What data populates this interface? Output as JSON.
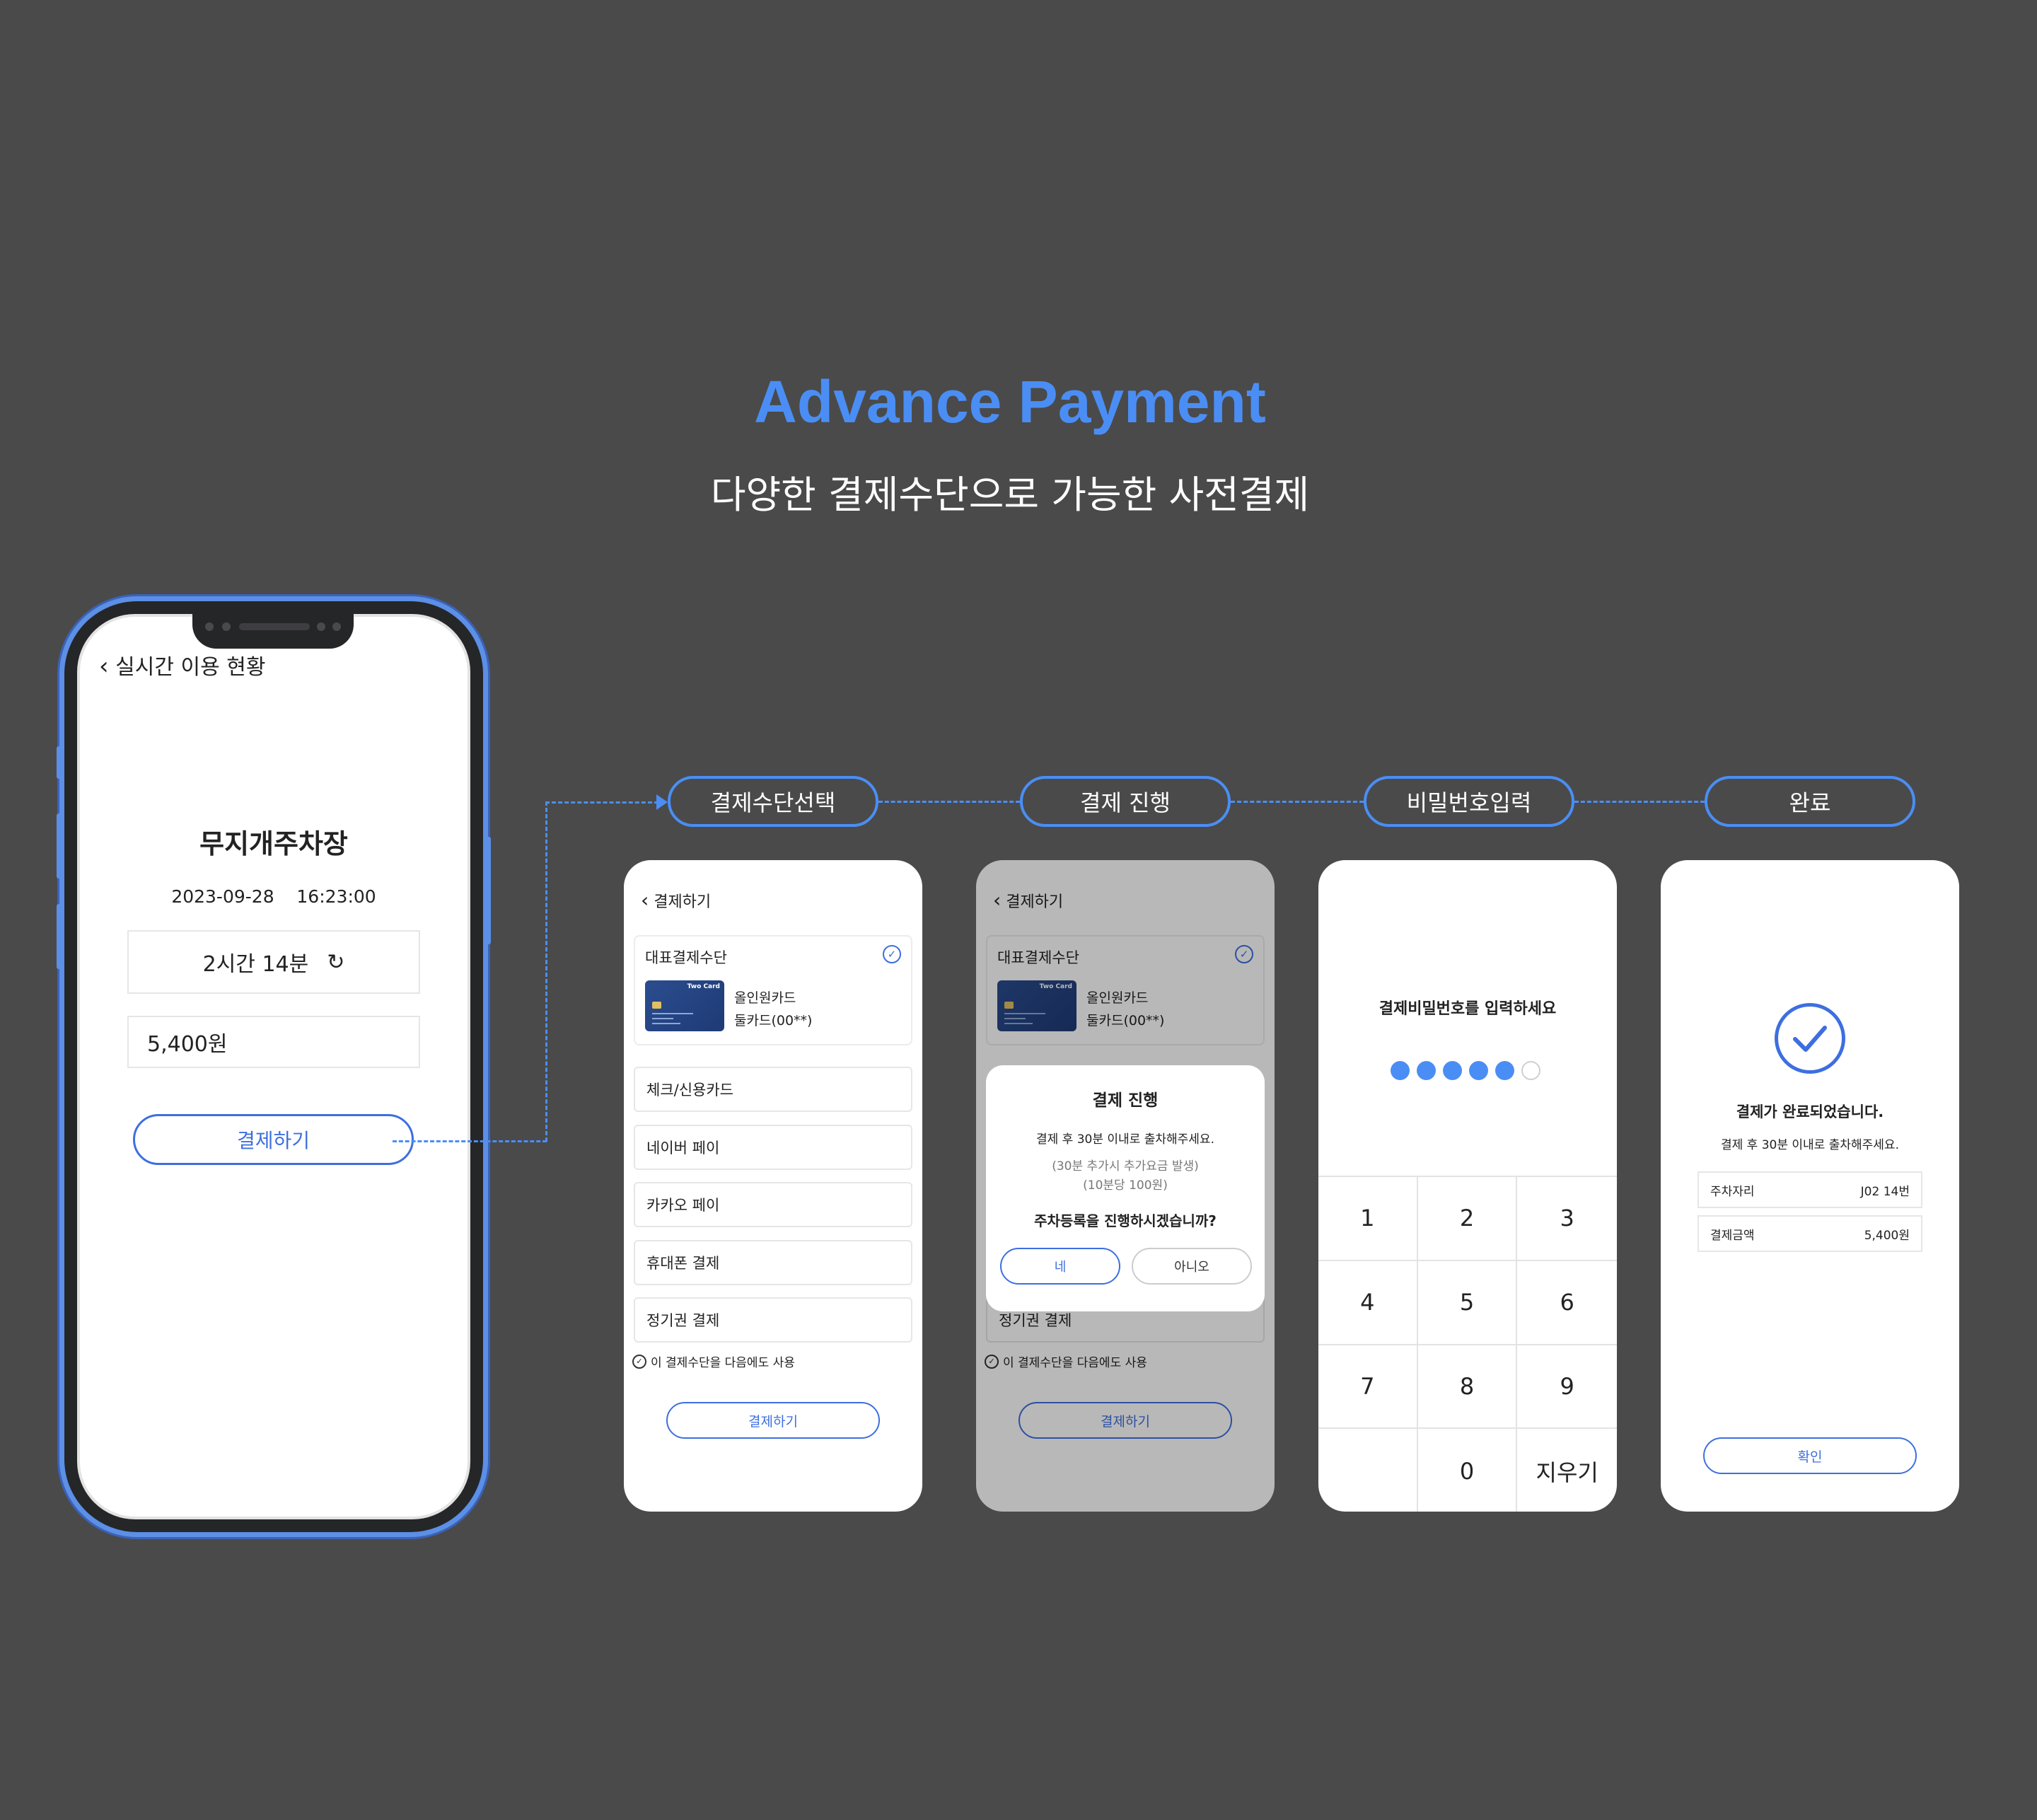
{
  "header": {
    "title": "Advance Payment",
    "subtitle": "다양한 결제수단으로 가능한 사전결제"
  },
  "phone": {
    "back_label": "실시간 이용 현황",
    "lot_name": "무지개주차장",
    "date": "2023-09-28",
    "time": "16:23:00",
    "duration": "2시간 14분",
    "fee": "5,400원",
    "pay_button": "결제하기"
  },
  "steps": [
    "결제수단선택",
    "결제 진행",
    "비밀번호입력",
    "완료"
  ],
  "select_screen": {
    "back_label": "결제하기",
    "rep_label": "대표결제수단",
    "card_brand": "Two Card",
    "card_name_1": "올인원카드",
    "card_name_2": "둘카드(00**)",
    "options": [
      "체크/신용카드",
      "네이버 페이",
      "카카오 페이",
      "휴대폰 결제",
      "정기권 결제"
    ],
    "reuse_label": "이 결제수단을 다음에도 사용",
    "pay_button": "결제하기"
  },
  "modal": {
    "title": "결제 진행",
    "line1": "결제 후 30분 이내로 출차해주세요.",
    "line2": "(30분 추가시 추가요금 발생)",
    "line3": "(10분당 100원)",
    "question": "주차등록을 진행하시겠습니까?",
    "yes": "네",
    "no": "아니오"
  },
  "password_screen": {
    "title": "결제비밀번호를 입력하세요",
    "filled_dots": 5,
    "total_dots": 6,
    "keys": [
      "1",
      "2",
      "3",
      "4",
      "5",
      "6",
      "7",
      "8",
      "9",
      "",
      "0",
      "지우기"
    ]
  },
  "done_screen": {
    "title": "결제가 완료되었습니다.",
    "subtitle": "결제 후 30분 이내로 출차해주세요.",
    "spot_label": "주차자리",
    "spot_value": "J02 14번",
    "amount_label": "결제금액",
    "amount_value": "5,400원",
    "ok_button": "확인"
  },
  "colors": {
    "accent": "#4a8ef5",
    "button_blue": "#3d6fe0",
    "background": "#4a4a4a"
  }
}
